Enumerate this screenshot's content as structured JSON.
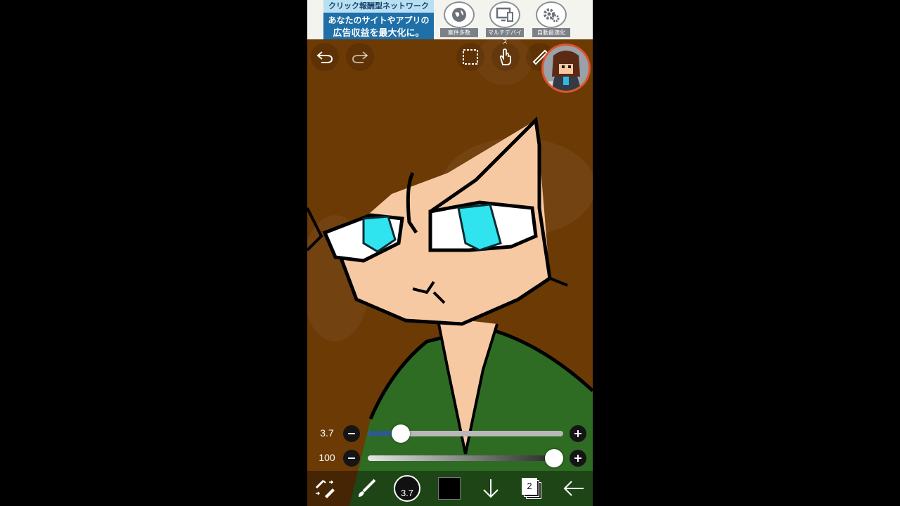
{
  "ad": {
    "headline": "クリック報酬型ネットワーク",
    "line1": "あなたのサイトやアプリの",
    "line2": "広告収益を最大化に。",
    "features": [
      {
        "icon": "globe-icon",
        "caption": "案件多数"
      },
      {
        "icon": "monitor-icon",
        "caption": "マルチデバイス"
      },
      {
        "icon": "gear-icon",
        "caption": "自動最適化"
      }
    ]
  },
  "toolbar": {
    "icons": [
      "undo-icon",
      "redo-icon",
      "selection-icon",
      "hand-icon",
      "ruler-icon"
    ]
  },
  "brush": {
    "size_label": "3.7",
    "size_value": 3.7,
    "size_fraction": 0.17,
    "opacity_label": "100",
    "opacity_fraction": 1.0
  },
  "bottom": {
    "brush_size": "3.7",
    "layer_count": "2",
    "color": "#000000",
    "icons": [
      "tools-icon",
      "brush-icon",
      "brush-size-icon",
      "color-swatch",
      "download-icon",
      "layers-icon",
      "back-arrow-icon"
    ]
  },
  "colors": {
    "background": "#6b3a05",
    "skin": "#f7c9a3",
    "eye": "#2fe3ef",
    "shirt": "#2e6b23",
    "avatar_ring": "#e0532e"
  }
}
